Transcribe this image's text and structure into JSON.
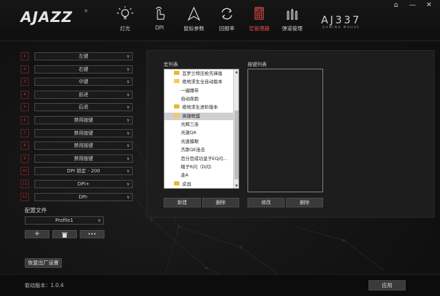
{
  "header": {
    "logo": "AJAZZ",
    "logo_mark": "®",
    "model": "AJ337",
    "model_sub": "GAMING MOUSE",
    "nav": [
      {
        "label": "灯光",
        "icon": "lightbulb-icon"
      },
      {
        "label": "DPI",
        "icon": "hand-pointer-icon"
      },
      {
        "label": "鼠标参数",
        "icon": "cursor-arrow-icon"
      },
      {
        "label": "回报率",
        "icon": "refresh-icon"
      },
      {
        "label": "宏管理器",
        "icon": "calculator-icon",
        "active": true
      },
      {
        "label": "弹道管理",
        "icon": "bullets-icon"
      }
    ],
    "window_controls": [
      "⌂",
      "—",
      "✕"
    ]
  },
  "key_map": {
    "rows": [
      {
        "num": "1",
        "value": "左键"
      },
      {
        "num": "2",
        "value": "右键"
      },
      {
        "num": "3",
        "value": "中键"
      },
      {
        "num": "4",
        "value": "前进"
      },
      {
        "num": "5",
        "value": "后退"
      },
      {
        "num": "6",
        "value": "禁用按键"
      },
      {
        "num": "7",
        "value": "禁用按键"
      },
      {
        "num": "8",
        "value": "禁用按键"
      },
      {
        "num": "9",
        "value": "禁用按键"
      },
      {
        "num": "10",
        "value": "DPI 锁定 - 200"
      },
      {
        "num": "11",
        "value": "DPI+"
      },
      {
        "num": "12",
        "value": "DPI-"
      }
    ]
  },
  "profile": {
    "label": "配置文件",
    "selected": "Profile1",
    "add_label": "+",
    "delete_label": "🗑",
    "more_label": "•••",
    "reset_label": "恢复出厂设置"
  },
  "macro": {
    "list_title": "宏列表",
    "key_list_title": "按键列表",
    "items": [
      {
        "text": "瓦罗兰特压枪先锋版",
        "folder": true,
        "open": false,
        "indent": 1
      },
      {
        "text": "绝地求生全自动版本",
        "folder": true,
        "open": true,
        "indent": 1
      },
      {
        "text": "一键蹲带",
        "folder": false,
        "indent": 2
      },
      {
        "text": "自动奔跑",
        "folder": false,
        "indent": 2
      },
      {
        "text": "绝地求生进阶版本",
        "folder": true,
        "open": false,
        "indent": 1
      },
      {
        "text": "英雄联盟",
        "folder": true,
        "open": true,
        "indent": 1,
        "selected": true
      },
      {
        "text": "光辉三连",
        "folder": false,
        "indent": 2
      },
      {
        "text": "光速QA",
        "folder": false,
        "indent": 2
      },
      {
        "text": "光速摸眼",
        "folder": false,
        "indent": 2
      },
      {
        "text": "杰斯QE连击",
        "folder": false,
        "indent": 2
      },
      {
        "text": "百分百成功皇子EQ闪...",
        "folder": false,
        "indent": 2
      },
      {
        "text": "瞎子R闪（D闪）",
        "folder": false,
        "indent": 2
      },
      {
        "text": "走A",
        "folder": false,
        "indent": 2
      },
      {
        "text": "逆战",
        "folder": true,
        "open": false,
        "indent": 1
      }
    ],
    "new_label": "新建",
    "delete_label": "删除",
    "edit_label": "修改",
    "delete2_label": "删除"
  },
  "footer": {
    "version": "驱动版本：1.0.4",
    "apply_label": "应用"
  },
  "colors": {
    "accent": "#e84a4a",
    "key_border": "#6e1f1f",
    "folder": "#e8b830"
  }
}
